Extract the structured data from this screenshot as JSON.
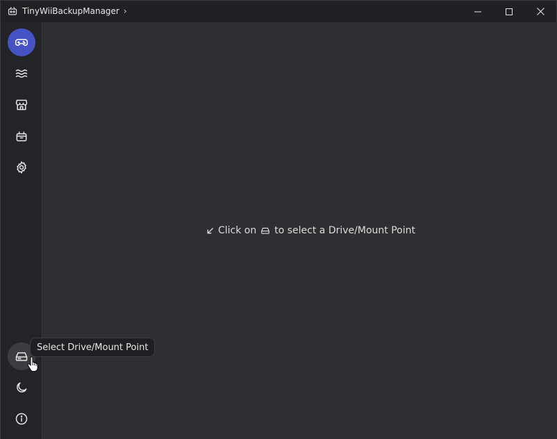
{
  "window": {
    "title": "TinyWiiBackupManager",
    "title_chevron": "›"
  },
  "sidebar": {
    "items": [
      {
        "name": "games",
        "icon": "gamepad-icon",
        "active": true
      },
      {
        "name": "wiiflow",
        "icon": "waves-icon"
      },
      {
        "name": "store",
        "icon": "store-icon"
      },
      {
        "name": "toolbox",
        "icon": "toolbox-icon"
      },
      {
        "name": "settings",
        "icon": "gear-icon"
      }
    ],
    "bottom_items": [
      {
        "name": "select-drive",
        "icon": "hard-drive-icon",
        "hovered": true
      },
      {
        "name": "theme",
        "icon": "moon-icon"
      },
      {
        "name": "about",
        "icon": "info-icon"
      }
    ]
  },
  "main": {
    "hint_before": "Click on",
    "hint_after": "to select a Drive/Mount Point"
  },
  "tooltip": {
    "text": "Select Drive/Mount Point"
  },
  "colors": {
    "accent": "#4752c4",
    "titlebar": "#202124",
    "sidebar": "#232427",
    "main": "#2e2f33"
  }
}
